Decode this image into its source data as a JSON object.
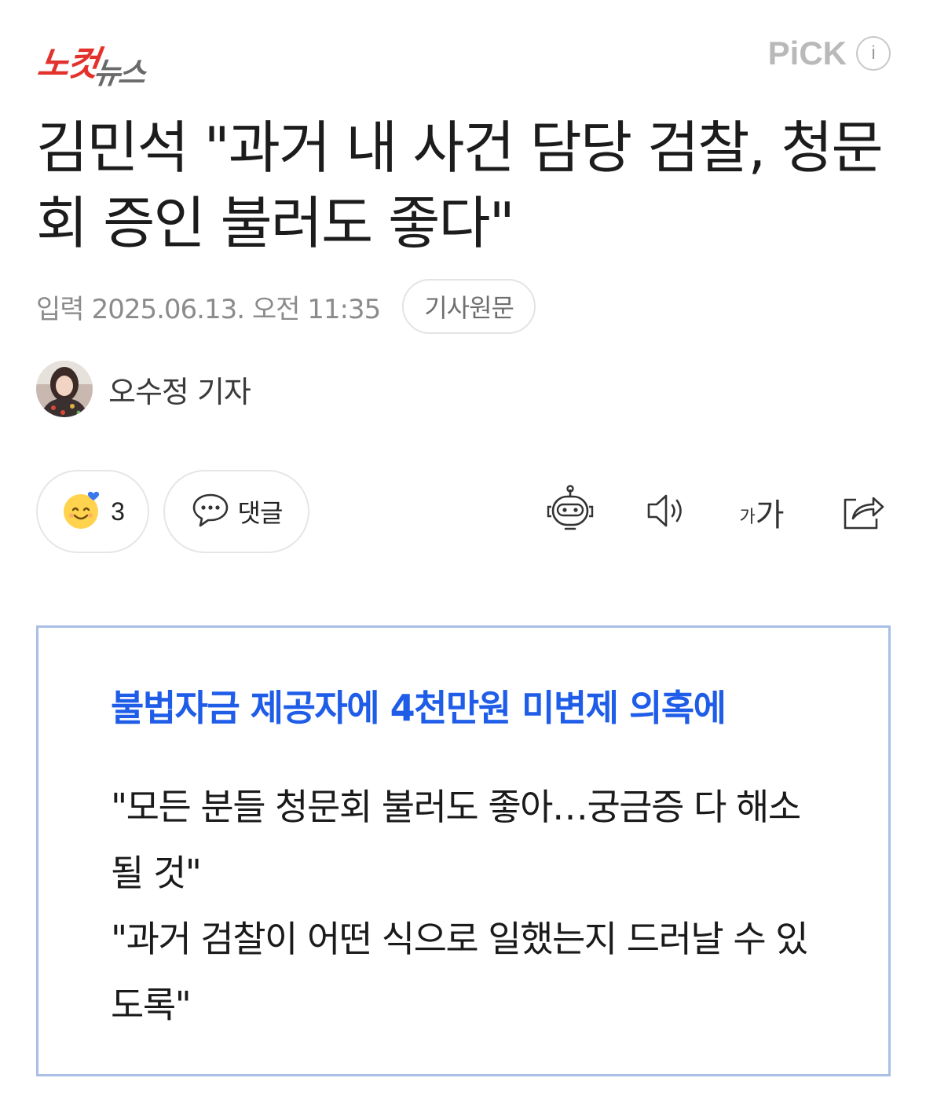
{
  "header": {
    "logo_part1": "노컷",
    "logo_part2": "뉴스",
    "pick_label": "PiCK",
    "info_label": "i"
  },
  "article": {
    "title": "김민석 \"과거 내 사건 담당 검찰, 청문회 증인 불러도 좋다\"",
    "meta_label": "입력",
    "date": "2025.06.13. 오전 11:35",
    "original_button": "기사원문",
    "reporter": "오수정 기자"
  },
  "actions": {
    "reaction_count": "3",
    "comment_label": "댓글",
    "font_small": "가",
    "font_large": "가"
  },
  "summary": {
    "heading": "불법자금 제공자에 4천만원 미변제 의혹에",
    "lines": [
      "\"모든 분들 청문회 불러도 좋아…궁금증 다 해소될 것\"",
      "\"과거 검찰이 어떤 식으로 일했는지 드러날 수 있도록\""
    ]
  },
  "colors": {
    "logo_red": "#e3322c",
    "heading_blue": "#1f5de9",
    "summary_border": "#a9bfe6",
    "meta_gray": "#8b8b8b"
  },
  "icons": [
    "info-icon",
    "smile-reaction-icon",
    "heart-badge-icon",
    "speech-bubble-icon",
    "ai-robot-icon",
    "speaker-icon",
    "share-icon"
  ]
}
